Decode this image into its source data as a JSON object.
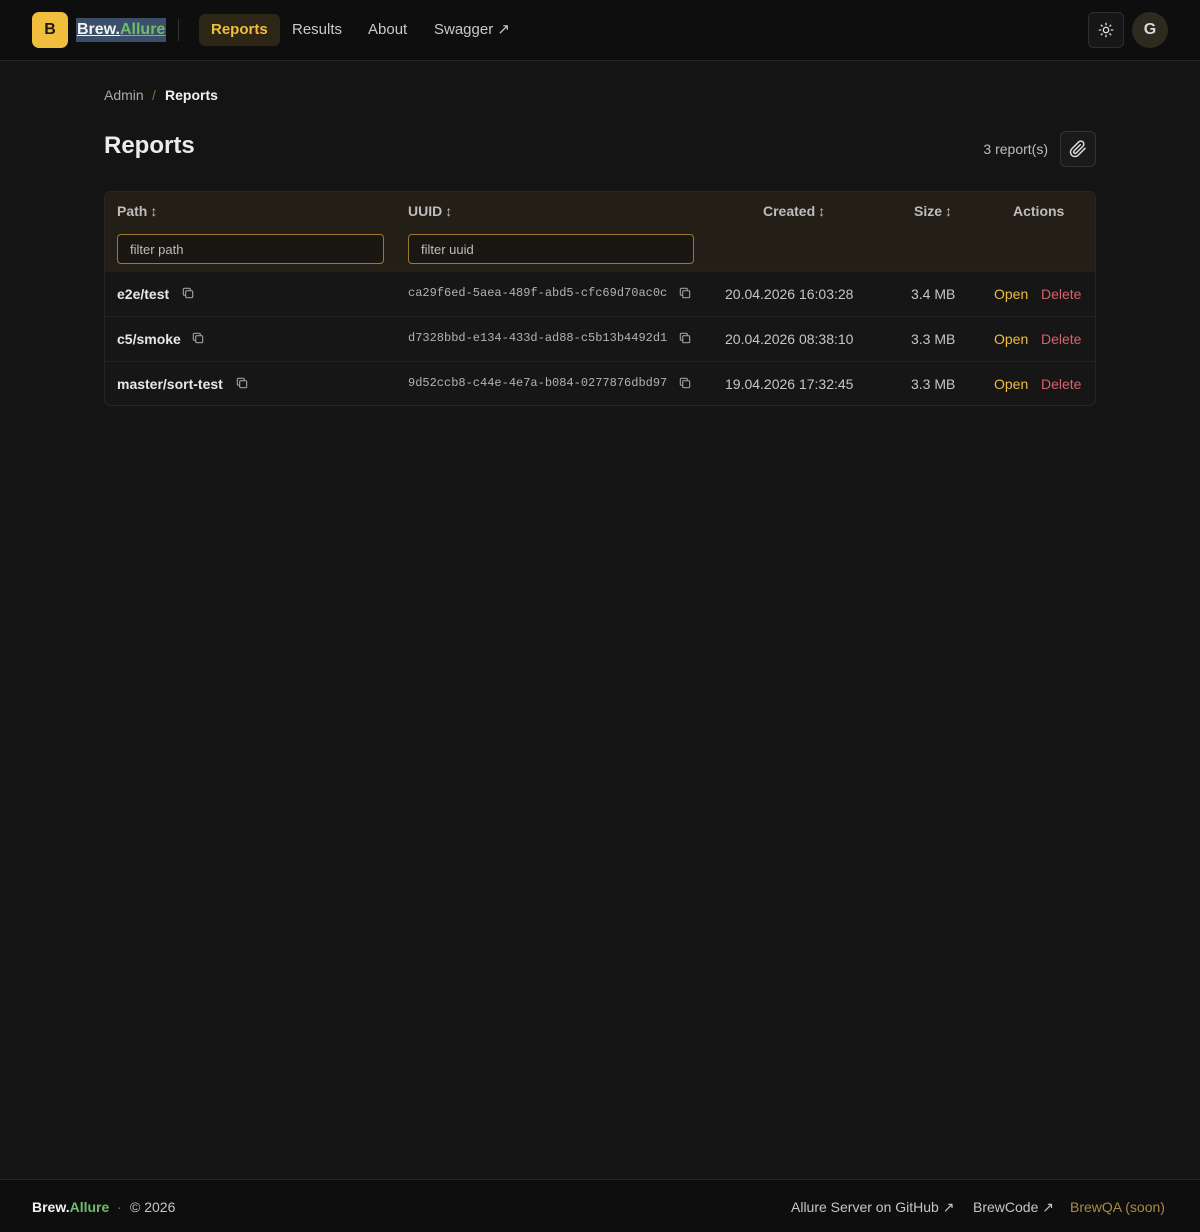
{
  "header": {
    "logo_letter": "B",
    "brand_part1": "Brew.",
    "brand_part2": "Allure",
    "nav": {
      "reports": "Reports",
      "results": "Results",
      "about": "About",
      "swagger": "Swagger ↗"
    },
    "active_nav": "reports",
    "avatar_letter": "G"
  },
  "breadcrumb": {
    "admin": "Admin",
    "separator": "/",
    "current": "Reports"
  },
  "page": {
    "title": "Reports",
    "count": "3 report(s)"
  },
  "table": {
    "columns": {
      "path": "Path",
      "uuid": "UUID",
      "created": "Created",
      "size": "Size",
      "actions": "Actions"
    },
    "sort_glyph": "↕",
    "filters": {
      "path_placeholder": "filter path",
      "uuid_placeholder": "filter uuid"
    },
    "rows": [
      {
        "path": "e2e/test",
        "uuid": "ca29f6ed-5aea-489f-abd5-cfc69d70ac0c",
        "created": "20.04.2026 16:03:28",
        "size": "3.4 MB",
        "open": "Open",
        "delete": "Delete"
      },
      {
        "path": "c5/smoke",
        "uuid": "d7328bbd-e134-433d-ad88-c5b13b4492d1",
        "created": "20.04.2026 08:38:10",
        "size": "3.3 MB",
        "open": "Open",
        "delete": "Delete"
      },
      {
        "path": "master/sort-test",
        "uuid": "9d52ccb8-c44e-4e7a-b084-0277876dbd97",
        "created": "19.04.2026 17:32:45",
        "size": "3.3 MB",
        "open": "Open",
        "delete": "Delete"
      }
    ]
  },
  "footer": {
    "brand_part1": "Brew.",
    "brand_part2": "Allure",
    "dot": "·",
    "copyright": "© 2026",
    "github_link": "Allure Server on GitHub ↗",
    "brewcode_link": "BrewCode ↗",
    "brewqa": "BrewQA (soon)"
  },
  "colors": {
    "accent": "#f0bd3c",
    "brand_green": "#6cbd6c",
    "danger": "#d8606b",
    "background": "#141414"
  },
  "icons": [
    "sun-icon",
    "paperclip-icon",
    "copy-icon"
  ]
}
